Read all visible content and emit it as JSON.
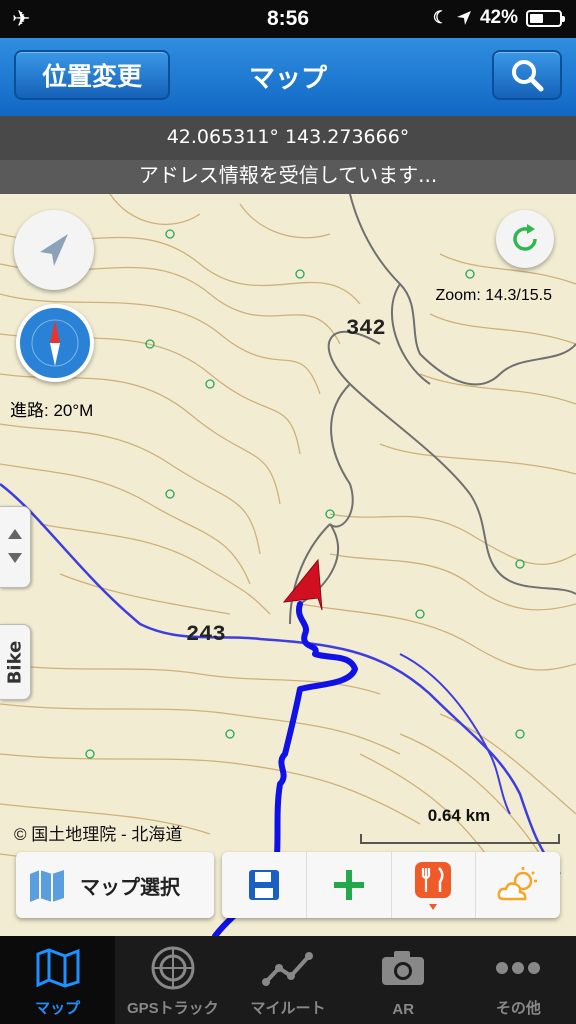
{
  "status_bar": {
    "time": "8:56",
    "battery": "42%",
    "battery_level": 0.42,
    "icons": [
      "airplane-icon",
      "moon-icon",
      "location-arrow-icon",
      "battery-icon"
    ]
  },
  "navbar": {
    "left_button": "位置変更",
    "title": "マップ",
    "right_icon": "search-icon"
  },
  "location": {
    "coords": "42.065311° 143.273666°",
    "address": "アドレス情報を受信しています..."
  },
  "map": {
    "zoom": "Zoom: 14.3/15.5",
    "heading": "進路: 20°M",
    "side_tab": "Bike",
    "copyright": "© 国土地理院 - 北海道",
    "scale": "0.64 km",
    "elevation_labels": [
      "342",
      "243"
    ],
    "track_color": "#1010e8",
    "marker_color": "#d01020"
  },
  "toolbar": {
    "map_select": "マップ選択",
    "actions": [
      "save-icon",
      "add-icon",
      "restaurant-icon",
      "weather-icon"
    ]
  },
  "tabs": [
    {
      "label": "マップ",
      "icon": "map-icon",
      "active": true
    },
    {
      "label": "GPSトラック",
      "icon": "radar-icon",
      "active": false
    },
    {
      "label": "マイルート",
      "icon": "route-icon",
      "active": false
    },
    {
      "label": "AR",
      "icon": "camera-icon",
      "active": false
    },
    {
      "label": "その他",
      "icon": "more-icon",
      "active": false
    }
  ]
}
